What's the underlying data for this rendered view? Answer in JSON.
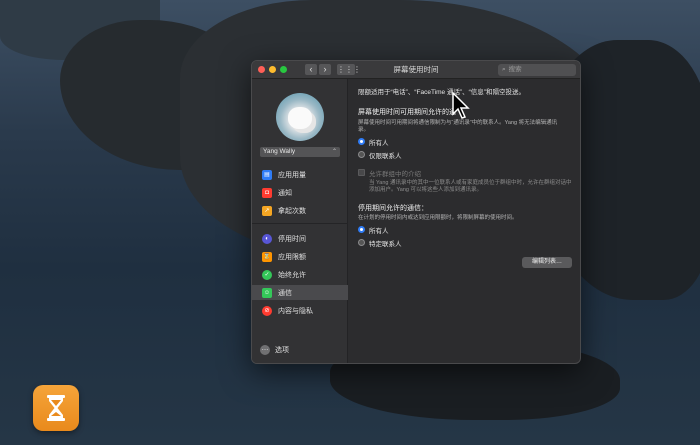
{
  "window": {
    "title": "屏幕使用时间",
    "search_placeholder": "搜索",
    "nav_back": "‹",
    "nav_forward": "›",
    "grid": "⋮⋮⋮"
  },
  "sidebar": {
    "user": "Yang Wally",
    "items": [
      {
        "label": "应用用量",
        "icon": "layers-icon",
        "color": "#2f7cf6"
      },
      {
        "label": "通知",
        "icon": "notification-icon",
        "color": "#ff3b30"
      },
      {
        "label": "拿起次数",
        "icon": "pickup-icon",
        "color": "#f5a623"
      },
      {
        "label": "停用时间",
        "icon": "downtime-icon",
        "color": "#5856d6"
      },
      {
        "label": "应用限额",
        "icon": "hourglass-icon",
        "color": "#ff9500"
      },
      {
        "label": "始终允许",
        "icon": "checkmark-icon",
        "color": "#34c759"
      },
      {
        "label": "通信",
        "icon": "communication-icon",
        "color": "#34c759"
      },
      {
        "label": "内容与隐私",
        "icon": "restriction-icon",
        "color": "#ff3b30"
      }
    ],
    "options_label": "选项"
  },
  "content": {
    "intro": "限额适用于“电话”、“FaceTime 通话”、“信息”和隔空投送。",
    "section1_title": "屏幕使用时间可用期间允许的通",
    "section1_desc_1": "屏幕使用时间可用期间将通信限制为与“通讯录”中的联系人。Yang 将无法编辑通讯",
    "section1_desc_2": "录。",
    "radio_all_1": "所有人",
    "radio_contacts_only": "仅限联系人",
    "group_checkbox": "允许群组中的介绍",
    "group_desc_1": "当 Yang 通讯录中的其中一位联系人或有家庭成员位于群组中时，允许在群组对话中",
    "group_desc_2": "添加用户。Yang 可以将这些人添加到通讯录。",
    "section2_title": "停用期间允许的通信：",
    "section2_desc": "在计划的停用时间内或达到应用限额时，将限制屏幕的使用时间。",
    "edit_button": "编辑列表…",
    "radio_all_2": "所有人",
    "radio_specific": "特定联系人"
  },
  "dock": {
    "app_icon": "screen-time-icon"
  }
}
